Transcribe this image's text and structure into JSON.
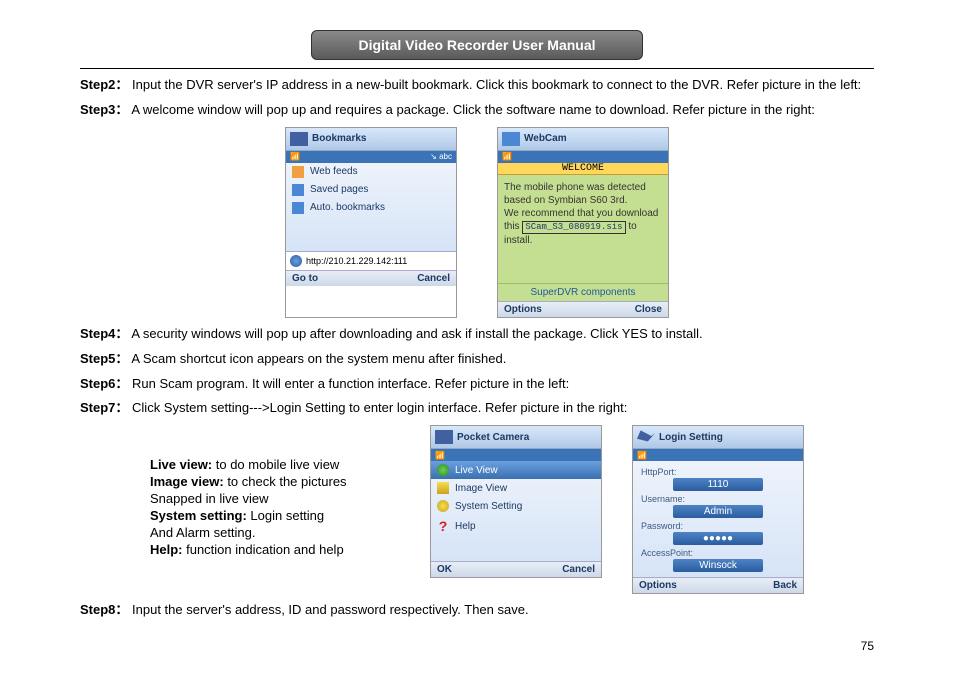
{
  "title": "Digital Video Recorder User Manual",
  "steps": {
    "s2": {
      "label": "Step2：",
      "text": "Input the DVR server's IP address in a new-built bookmark. Click this bookmark to connect to the DVR. Refer picture in the left:"
    },
    "s3": {
      "label": "Step3：",
      "text": "A welcome window will pop up and requires a package. Click the software name to download. Refer picture in the right:"
    },
    "s4": {
      "label": "Step4：",
      "text": "A security windows will pop up after downloading and ask if install the package. Click YES to install."
    },
    "s5": {
      "label": "Step5：",
      "text": "A Scam shortcut icon appears on the system menu after finished."
    },
    "s6": {
      "label": "Step6：",
      "text": "Run Scam program. It will enter a function interface. Refer picture in the left:"
    },
    "s7": {
      "label": "Step7：",
      "text": "Click System setting--->Login Setting to enter login interface. Refer picture in the right:"
    },
    "s8": {
      "label": "Step8：",
      "text": "Input the server's address, ID and password respectively. Then save."
    }
  },
  "bookmarks": {
    "header": "Bookmarks",
    "status_right": "↘ abc",
    "status_left": "📶",
    "items": [
      "Web feeds",
      "Saved pages",
      "Auto. bookmarks"
    ],
    "url": "http://210.21.229.142:111",
    "soft_left": "Go to",
    "soft_right": "Cancel"
  },
  "welcome": {
    "header": "WebCam",
    "welcome": "WELCOME",
    "body1": "The mobile phone was detected based on Symbian S60 3rd.",
    "body2": "We recommend that you download this",
    "link": "SCam_S3_080919.sis",
    "body3": "to install.",
    "components": "SuperDVR components",
    "soft_left": "Options",
    "soft_right": "Close"
  },
  "legend": {
    "l1a": "Live view:",
    "l1b": " to do mobile live view",
    "l2a": "Image view:",
    "l2b": " to check the pictures",
    "l3": "Snapped in live view",
    "l4a": "System setting:",
    "l4b": " Login setting",
    "l5": "And Alarm setting.",
    "l6a": "Help:",
    "l6b": " function indication and help"
  },
  "pocket": {
    "header": "Pocket Camera",
    "items": [
      "Live View",
      "Image View",
      "System Setting",
      "Help"
    ],
    "soft_left": "OK",
    "soft_right": "Cancel"
  },
  "login": {
    "header": "Login Setting",
    "fields": {
      "port_label": "HttpPort:",
      "port_value": "1110",
      "user_label": "Username:",
      "user_value": "Admin",
      "pass_label": "Password:",
      "pass_value": "●●●●●",
      "ap_label": "AccessPoint:",
      "ap_value": "Winsock"
    },
    "soft_left": "Options",
    "soft_right": "Back"
  },
  "page": "75"
}
